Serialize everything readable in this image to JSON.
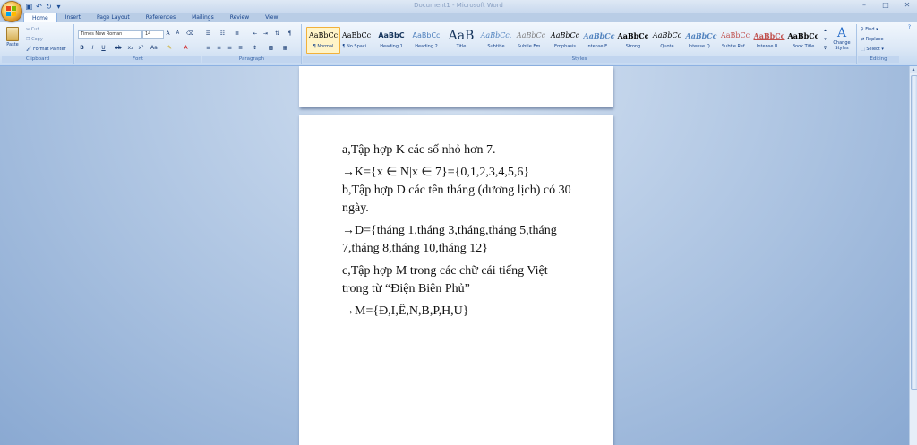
{
  "window": {
    "title": "Document1 - Microsoft Word"
  },
  "tabs": [
    {
      "label": "Home",
      "active": true
    },
    {
      "label": "Insert"
    },
    {
      "label": "Page Layout"
    },
    {
      "label": "References"
    },
    {
      "label": "Mailings"
    },
    {
      "label": "Review"
    },
    {
      "label": "View"
    }
  ],
  "clipboard": {
    "paste": "Paste",
    "cut": "Cut",
    "copy": "Copy",
    "format_painter": "Format Painter",
    "label": "Clipboard"
  },
  "font": {
    "name": "Times New Roman",
    "size": "14",
    "label": "Font"
  },
  "paragraph": {
    "label": "Paragraph"
  },
  "styles": {
    "label": "Styles",
    "items": [
      {
        "sample": "AaBbCc",
        "name": "¶ Normal",
        "selected": true
      },
      {
        "sample": "AaBbCc",
        "name": "¶ No Spaci..."
      },
      {
        "sample": "AaBbC",
        "name": "Heading 1"
      },
      {
        "sample": "AaBbCc",
        "name": "Heading 2"
      },
      {
        "sample": "AaB",
        "name": "Title"
      },
      {
        "sample": "AaBbCc.",
        "name": "Subtitle"
      },
      {
        "sample": "AaBbCc",
        "name": "Subtle Em..."
      },
      {
        "sample": "AaBbCc",
        "name": "Emphasis"
      },
      {
        "sample": "AaBbCc",
        "name": "Intense E..."
      },
      {
        "sample": "AaBbCc",
        "name": "Strong"
      },
      {
        "sample": "AaBbCc",
        "name": "Quote"
      },
      {
        "sample": "AaBbCc",
        "name": "Intense Q..."
      },
      {
        "sample": "AaBbCc",
        "name": "Subtle Ref..."
      },
      {
        "sample": "AaBbCc",
        "name": "Intense R..."
      },
      {
        "sample": "AaBbCc",
        "name": "Book Title"
      }
    ],
    "change_styles": "Change Styles"
  },
  "editing": {
    "find": "Find",
    "replace": "Replace",
    "select": "Select",
    "label": "Editing"
  },
  "document": {
    "paragraphs": [
      "a,Tập hợp K các số nhỏ hơn 7.",
      "→K={x ∈ N|x ∈ 7}={0,1,2,3,4,5,6}",
      "b,Tập hợp D các tên tháng (dương lịch) có 30 ngày.",
      "→D={tháng 1,tháng 3,tháng,tháng 5,tháng 7,tháng 8,tháng 10,tháng 12}",
      "c,Tập hợp M trong các chữ cái tiếng Việt trong từ “Điện Biên Phủ”",
      "→M={Đ,I,Ê,N,B,P,H,U}"
    ]
  },
  "colors": {
    "accent": "#15428b",
    "ribbon": "#dce8f6",
    "workspace": "#a9c1e0"
  }
}
